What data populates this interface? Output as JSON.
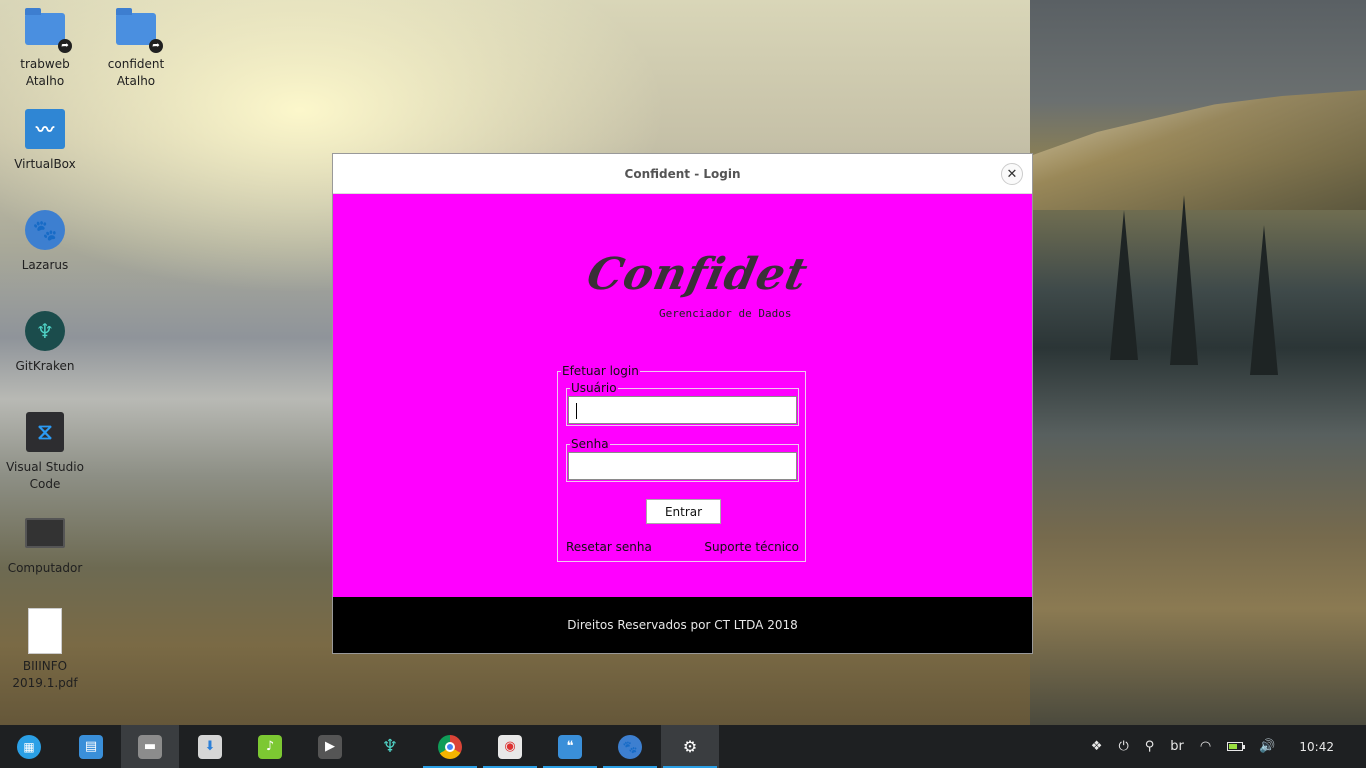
{
  "desktop": {
    "icons": [
      {
        "label": "trabweb\nAtalho"
      },
      {
        "label": "confident\nAtalho"
      },
      {
        "label": "VirtualBox"
      },
      {
        "label": "Lazarus"
      },
      {
        "label": "GitKraken"
      },
      {
        "label": "Visual Studio\nCode"
      },
      {
        "label": "Computador"
      },
      {
        "label": "BIIINFO\n2019.1.pdf"
      }
    ]
  },
  "dialog": {
    "title": "Confident - Login",
    "close_glyph": "✕",
    "logo_text": "Confidet",
    "logo_subtitle": "Gerenciador de Dados",
    "login_group_label": "Efetuar login",
    "username_label": "Usuário",
    "username_value": "",
    "password_label": "Senha",
    "password_value": "",
    "enter_button": "Entrar",
    "reset_link": "Resetar senha",
    "support_link": "Suporte técnico",
    "footer_text": "Direitos Reservados por CT LTDA 2018",
    "colors": {
      "body": "#ff00ff",
      "footer": "#000000"
    }
  },
  "taskbar": {
    "tray": {
      "keyboard_layout": "br",
      "clock": "10:42"
    }
  }
}
